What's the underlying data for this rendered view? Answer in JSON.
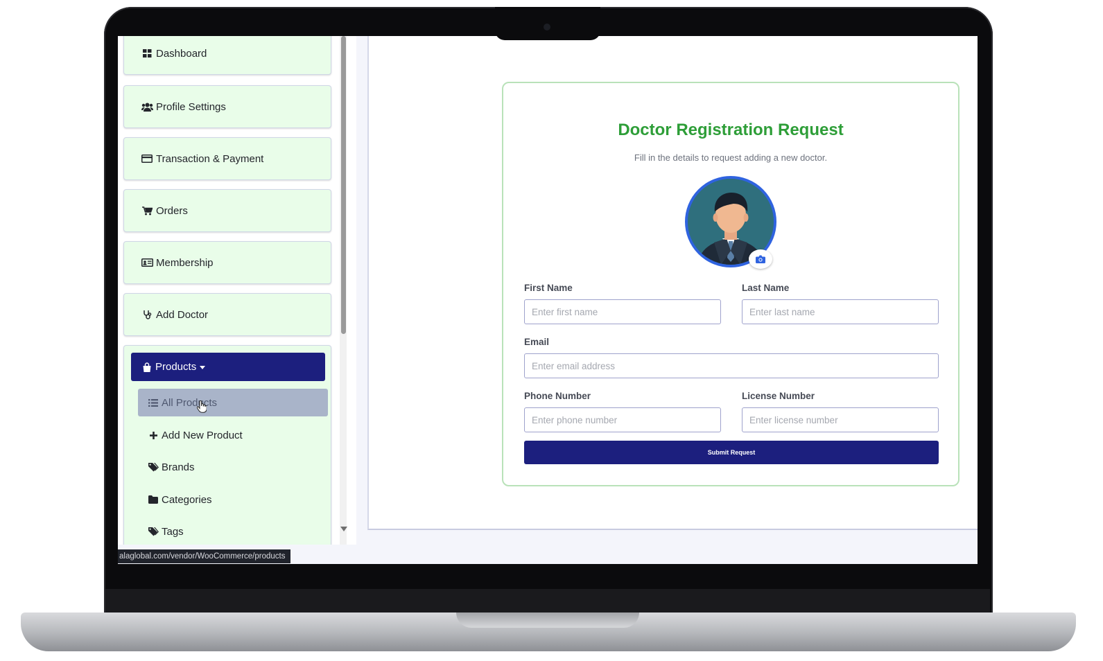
{
  "sidebar": {
    "items": [
      {
        "label": "Dashboard",
        "icon": "dashboard-icon"
      },
      {
        "label": "Profile Settings",
        "icon": "users-icon"
      },
      {
        "label": "Transaction & Payment",
        "icon": "credit-card-icon"
      },
      {
        "label": "Orders",
        "icon": "cart-icon"
      },
      {
        "label": "Membership",
        "icon": "id-card-icon"
      },
      {
        "label": "Add Doctor",
        "icon": "stethoscope-icon"
      }
    ],
    "products": {
      "label": "Products",
      "icon": "shopping-bag-icon",
      "subitems": [
        {
          "label": "All Products",
          "icon": "list-icon",
          "active": true
        },
        {
          "label": "Add New Product",
          "icon": "plus-icon"
        },
        {
          "label": "Brands",
          "icon": "tags-icon"
        },
        {
          "label": "Categories",
          "icon": "folder-icon"
        },
        {
          "label": "Tags",
          "icon": "tags-icon"
        }
      ]
    }
  },
  "status_bar": {
    "url": "alaglobal.com/vendor/WooCommerce/products"
  },
  "form": {
    "title": "Doctor Registration Request",
    "subtitle": "Fill in the details to request adding a new doctor.",
    "first_name": {
      "label": "First Name",
      "placeholder": "Enter first name",
      "value": ""
    },
    "last_name": {
      "label": "Last Name",
      "placeholder": "Enter last name",
      "value": ""
    },
    "email": {
      "label": "Email",
      "placeholder": "Enter email address",
      "value": ""
    },
    "phone": {
      "label": "Phone Number",
      "placeholder": "Enter phone number",
      "value": ""
    },
    "license": {
      "label": "License Number",
      "placeholder": "Enter license number",
      "value": ""
    },
    "submit_label": "Submit Request"
  },
  "colors": {
    "sidebar_bg": "#e9fde9",
    "accent_navy": "#1c1f7e",
    "title_green": "#2e9e38",
    "avatar_ring": "#2f63e0"
  }
}
